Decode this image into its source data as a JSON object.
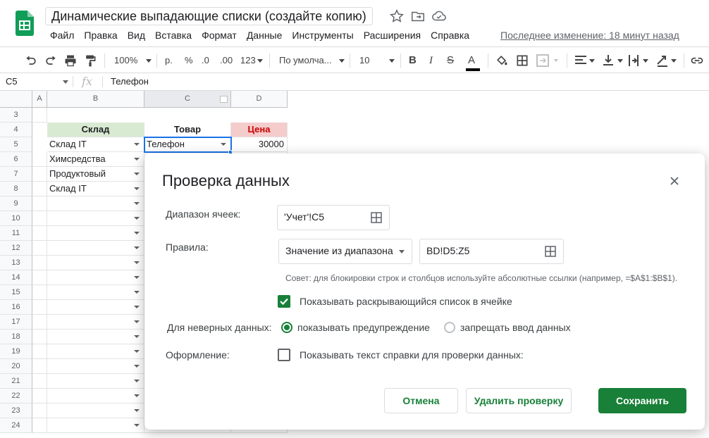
{
  "header": {
    "doc_title": "Динамические выпадающие списки (создайте копию)",
    "last_edit": "Последнее изменение: 18 минут назад"
  },
  "menu": [
    "Файл",
    "Правка",
    "Вид",
    "Вставка",
    "Формат",
    "Данные",
    "Инструменты",
    "Расширения",
    "Справка"
  ],
  "toolbar": {
    "zoom": "100%",
    "currency": "р.",
    "percent": "%",
    "dec_less": ".0",
    "dec_more": ".00",
    "number_format": "123",
    "font_name": "По умолча...",
    "font_size": "10",
    "bold": "B",
    "italic": "I",
    "strike": "S",
    "text_color": "A"
  },
  "formula_bar": {
    "cell_ref": "C5",
    "fx": "fx",
    "value": "Телефон"
  },
  "sheet": {
    "columns": [
      "A",
      "B",
      "C",
      "D"
    ],
    "row_numbers": [
      "3",
      "4",
      "5",
      "6",
      "7",
      "8",
      "9",
      "10",
      "11",
      "12",
      "13",
      "14",
      "15",
      "16",
      "17",
      "18",
      "19",
      "20",
      "21",
      "22",
      "23",
      "24"
    ],
    "header_row": {
      "b": "Склад",
      "c": "Товар",
      "d": "Цена"
    },
    "row5": {
      "b": "Склад IT",
      "c": "Телефон",
      "d": "30000"
    },
    "b_values": [
      "Химсредства",
      "Продуктовый",
      "Склад IT"
    ],
    "colors": {
      "b_header": "#d9ead3",
      "d_header": "#f4cccc",
      "selection": "#1a73e8"
    }
  },
  "dialog": {
    "title": "Проверка данных",
    "range_label": "Диапазон ячеек:",
    "range_value": "'Учет'!C5",
    "rules_label": "Правила:",
    "rule_type": "Значение из диапазона",
    "rule_range": "BD!D5:Z5",
    "tip": "Совет: для блокировки строк и столбцов используйте абсолютные ссылки (например, =$A$1:$B$1).",
    "show_dropdown_label": "Показывать раскрывающийся список в ячейке",
    "show_dropdown_checked": true,
    "invalid_label": "Для неверных данных:",
    "invalid_warn": "показывать предупреждение",
    "invalid_reject": "запрещать ввод данных",
    "invalid_selected": "warn",
    "appearance_label": "Оформление:",
    "help_text_label": "Показывать текст справки для проверки данных:",
    "help_text_checked": false,
    "cancel": "Отмена",
    "remove": "Удалить проверку",
    "save": "Сохранить",
    "accent": "#188038"
  }
}
